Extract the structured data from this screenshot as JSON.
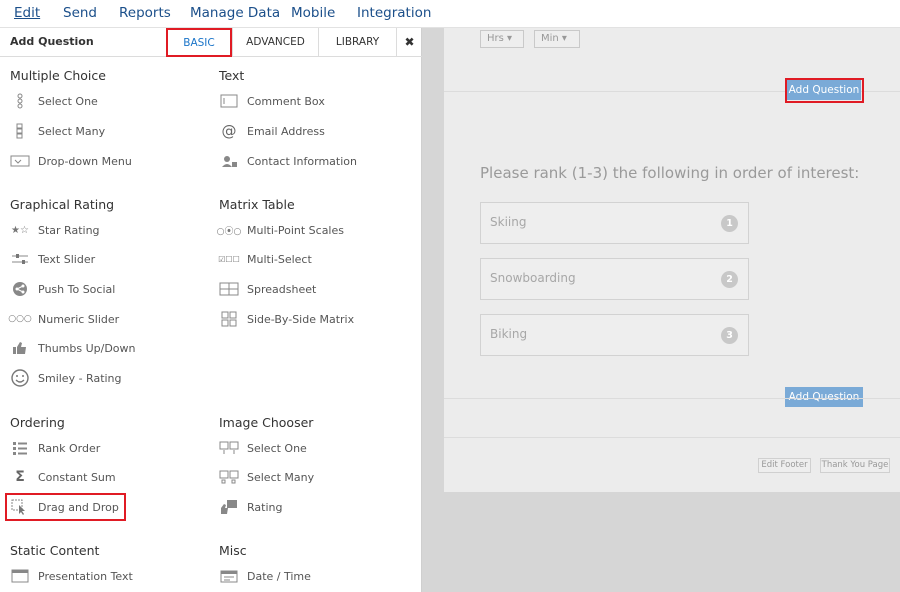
{
  "nav": {
    "items": [
      "Edit",
      "Send",
      "Reports",
      "Manage Data",
      "Mobile",
      "Integration"
    ]
  },
  "panel": {
    "title": "Add Question",
    "tabs": {
      "basic": "BASIC",
      "advanced": "ADVANCED",
      "library": "LIBRARY",
      "close": "✖"
    },
    "categories": {
      "multiple_choice": "Multiple Choice",
      "text": "Text",
      "graphical_rating": "Graphical Rating",
      "matrix_table": "Matrix Table",
      "ordering": "Ordering",
      "image_chooser": "Image Chooser",
      "static_content": "Static Content",
      "misc": "Misc"
    },
    "items": {
      "select_one": "Select One",
      "select_many": "Select Many",
      "dropdown_menu": "Drop-down Menu",
      "comment_box": "Comment Box",
      "email_address": "Email Address",
      "contact_information": "Contact Information",
      "star_rating": "Star Rating",
      "text_slider": "Text Slider",
      "push_to_social": "Push To Social",
      "numeric_slider": "Numeric Slider",
      "thumbs_up_down": "Thumbs Up/Down",
      "smiley_rating": "Smiley - Rating",
      "multi_point_scales": "Multi-Point Scales",
      "multi_select": "Multi-Select",
      "spreadsheet": "Spreadsheet",
      "side_by_side_matrix": "Side-By-Side Matrix",
      "rank_order": "Rank Order",
      "constant_sum": "Constant Sum",
      "drag_and_drop": "Drag and Drop",
      "image_select_one": "Select One",
      "image_select_many": "Select Many",
      "image_rating": "Rating",
      "presentation_text": "Presentation Text",
      "date_time": "Date / Time"
    }
  },
  "canvas": {
    "hrs": "Hrs ▾",
    "min": "Min ▾",
    "add_question_top": "Add Question",
    "add_question_bottom": "Add Question",
    "question": "Please rank (1-3) the following in order of interest:",
    "rank_items": [
      {
        "label": "Skiing",
        "num": "1"
      },
      {
        "label": "Snowboarding",
        "num": "2"
      },
      {
        "label": "Biking",
        "num": "3"
      }
    ],
    "edit_footer": "Edit Footer",
    "thank_you_page": "Thank You Page"
  }
}
